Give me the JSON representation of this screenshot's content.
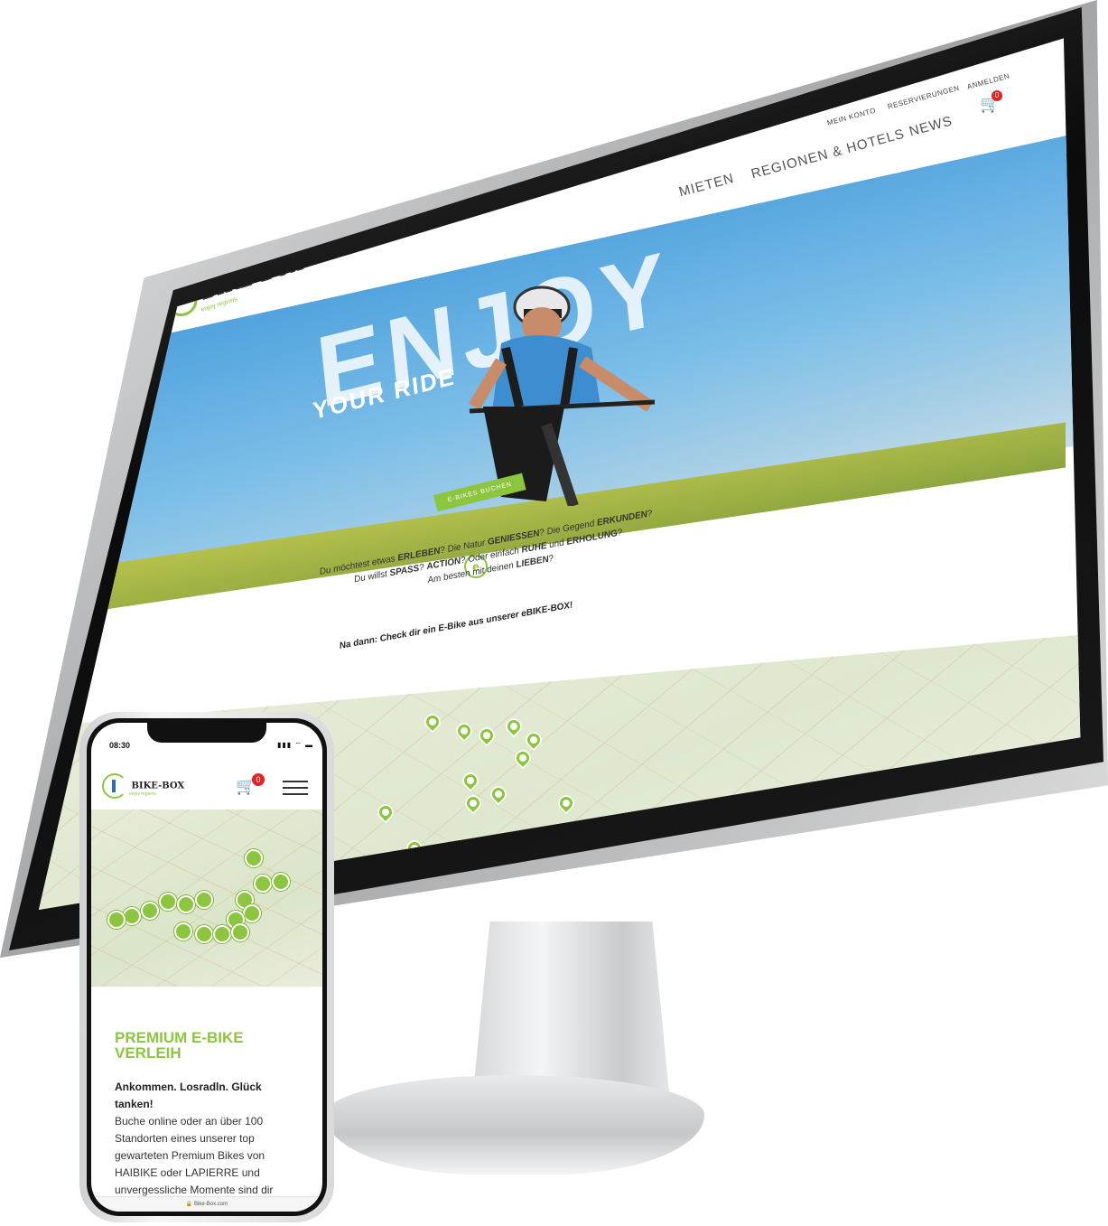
{
  "desktop": {
    "logo": {
      "text": "BIKE-BOX",
      "tagline": "enjoy regions"
    },
    "top_nav": [
      "MEIN KONTO",
      "RESERVIERUNGEN",
      "ANMELDEN"
    ],
    "main_nav": [
      "MIETEN",
      "REGIONEN & HOTELS",
      "NEWS"
    ],
    "cart_count": "0",
    "hero": {
      "headline": "ENJOY",
      "subheadline": "YOUR RIDE",
      "cta": "E-BIKES BUCHEN"
    },
    "intro": {
      "line1_a": "Du möchtest etwas ",
      "line1_b": "ERLEBEN",
      "line1_c": "? Die Natur ",
      "line1_d": "GENIESSEN",
      "line1_e": "? Die Gegend ",
      "line1_f": "ERKUNDEN",
      "line1_g": "?",
      "line2_a": "Du willst ",
      "line2_b": "SPASS",
      "line2_c": "? ",
      "line2_d": "ACTION",
      "line2_e": "? Oder einfach ",
      "line2_f": "RUHE",
      "line2_g": " und ",
      "line2_h": "ERHOLUNG",
      "line2_i": "?",
      "line3_a": "Am besten mit deinen ",
      "line3_b": "LIEBEN",
      "line3_c": "?",
      "cta_line": "Na dann: Check dir ein E-Bike aus unserer eBIKE-BOX!"
    }
  },
  "phone": {
    "status_time": "08:30",
    "status_icons": "▮▮▮ ⌔ ▬",
    "logo": {
      "text": "BIKE-BOX",
      "tagline": "enjoy regions"
    },
    "cart_count": "0",
    "title": "PREMIUM E-BIKE VERLEIH",
    "lead": "Ankommen. Losradln. Glück tanken!",
    "body": "Buche online oder an über 100 Standorten eines unserer top gewarteten Premium Bikes von HAIBIKE oder LAPIERRE und unvergessliche Momente sind dir garantiert",
    "url": "🔒 Bike-Box.com"
  },
  "colors": {
    "brand_green": "#8cc63f",
    "badge_red": "#e32222"
  },
  "icons": [
    "cart-icon",
    "hamburger-icon",
    "lock-icon",
    "map-pin-icon"
  ]
}
